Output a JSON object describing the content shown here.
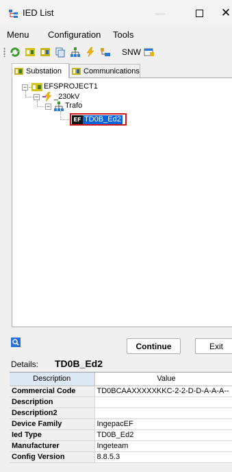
{
  "window": {
    "title": "IED List",
    "min": "—",
    "max": "☐",
    "close": "✕"
  },
  "menu": {
    "items": [
      "Menu",
      "Configuration",
      "Tools"
    ]
  },
  "toolbar": {
    "snw_label": "SNW"
  },
  "tabs": [
    {
      "label": "Substation"
    },
    {
      "label": "Communications"
    }
  ],
  "tree": {
    "root": {
      "label": "EFSPROJECT1"
    },
    "voltage": {
      "label": "_230kV"
    },
    "bay": {
      "label": "Trafo"
    },
    "ied": {
      "label": "TD0B_Ed2",
      "icon_text": "EF"
    }
  },
  "buttons": {
    "continue": "Continue",
    "exit": "Exit"
  },
  "details": {
    "label": "Details:",
    "value": "TD0B_Ed2"
  },
  "table": {
    "headers": [
      "Description",
      "Value"
    ],
    "rows": [
      {
        "key": "Commercial Code",
        "value": "TD0BCAAXXXXXKKC-2-2-D-D-A-A-A--"
      },
      {
        "key": "Description",
        "value": ""
      },
      {
        "key": "Description2",
        "value": ""
      },
      {
        "key": "Device Family",
        "value": "IngepacEF"
      },
      {
        "key": "Ied Type",
        "value": "TD0B_Ed2"
      },
      {
        "key": "Manufacturer",
        "value": "Ingeteam"
      },
      {
        "key": "Config Version",
        "value": "8.8.5.3"
      }
    ]
  },
  "colors": {
    "selection": "#0a64d8",
    "highlight_border": "#d21414",
    "header_bg": "#dde8f5"
  }
}
